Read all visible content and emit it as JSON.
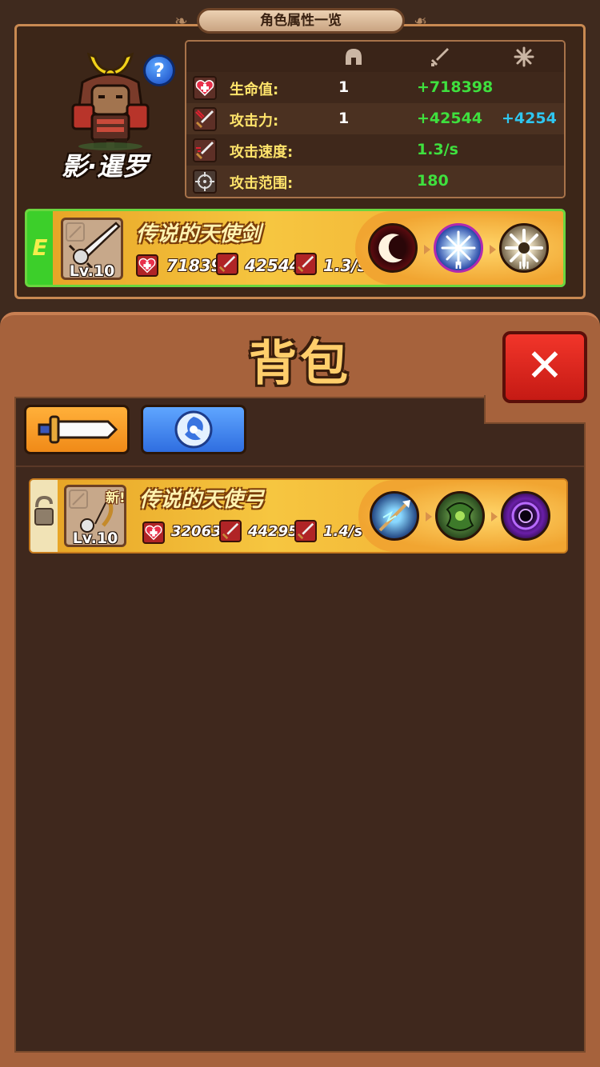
{
  "header": {
    "title": "角色属性一览"
  },
  "hero": {
    "name": "影·暹罗",
    "help_label": "?"
  },
  "stats": {
    "column_icons": [
      "helmet-icon",
      "sword-icon",
      "sparkle-icon"
    ],
    "rows": [
      {
        "icon": "heart-icon",
        "label": "生命值:",
        "base": "1",
        "equip": "+718398",
        "bonus": ""
      },
      {
        "icon": "sword-attack-icon",
        "label": "攻击力:",
        "base": "1",
        "equip": "+42544",
        "bonus": "+4254"
      },
      {
        "icon": "attack-speed-icon",
        "label": "攻击速度:",
        "base": "",
        "equip": "1.3/s",
        "bonus": ""
      },
      {
        "icon": "crosshair-icon",
        "label": "攻击范围:",
        "base": "",
        "equip": "180",
        "bonus": ""
      }
    ]
  },
  "equipped": {
    "tag": "E",
    "name": "传说的天使剑",
    "level": "Lv.10",
    "hp": "71839",
    "atk": "42544",
    "speed": "1.3/s",
    "skills": [
      "crescent-moon-skill-icon",
      "ice-star-skill-icon",
      "spike-burst-skill-icon"
    ],
    "skill_ranks": [
      "",
      "II",
      "III"
    ]
  },
  "bag": {
    "title": "背包",
    "close_label": "✕",
    "tabs": [
      {
        "name": "weapon-tab",
        "icon": "sword-icon"
      },
      {
        "name": "skill-tab",
        "icon": "swirl-icon"
      }
    ],
    "items": [
      {
        "name": "传说的天使弓",
        "level": "Lv.10",
        "new_label": "新!",
        "hp": "320636",
        "atk": "44295",
        "speed": "1.4/s",
        "skills": [
          "lightning-arrow-skill-icon",
          "poison-claw-skill-icon",
          "void-vortex-skill-icon"
        ]
      }
    ]
  },
  "colors": {
    "stat_label": "#ffe46b",
    "stat_green": "#3fe03e",
    "stat_blue": "#2fc6f0",
    "equipped_border": "#6ad63f",
    "close_red": "#e02a20"
  }
}
